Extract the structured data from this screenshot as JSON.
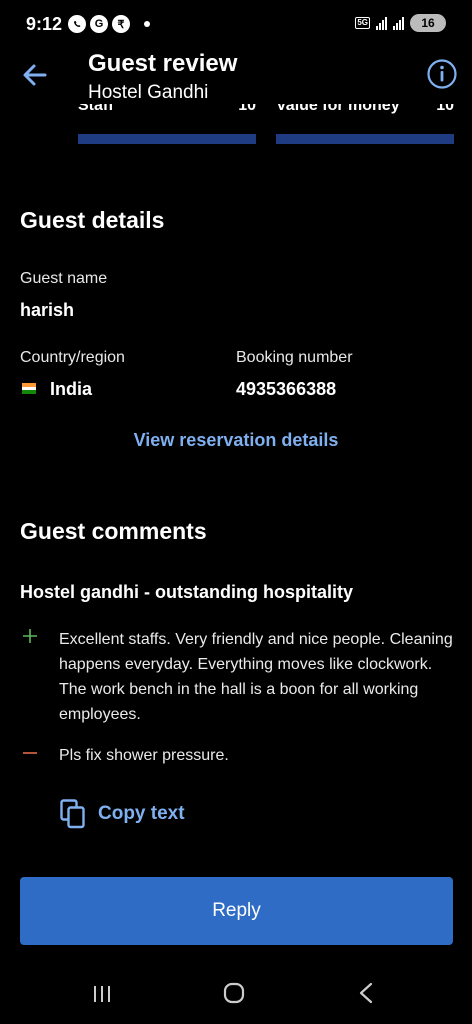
{
  "status_bar": {
    "time": "9:12",
    "left_icons": [
      "whatsapp-icon",
      "google-icon",
      "rupee-icon",
      "notification-dot"
    ],
    "rupee_glyph": "₹",
    "google_glyph": "G",
    "network": "5G",
    "battery": "16"
  },
  "header": {
    "title": "Guest review",
    "subtitle": "Hostel Gandhi"
  },
  "scores": [
    {
      "label": "Staff",
      "value": "10",
      "level": 1.0
    },
    {
      "label": "Value for money",
      "value": "10",
      "level": 1.0
    }
  ],
  "guest_details": {
    "heading": "Guest details",
    "name_label": "Guest name",
    "name_value": "harish",
    "country_label": "Country/region",
    "country_value": "India",
    "booking_label": "Booking number",
    "booking_value": "4935366388",
    "view_link": "View reservation details"
  },
  "guest_comments": {
    "heading": "Guest comments",
    "review_title": "Hostel gandhi - outstanding hospitality",
    "positive": "Excellent staffs. Very friendly and nice people. Cleaning happens everyday. Everything moves like clockwork. The work bench in the hall is a boon for all working employees.",
    "negative": "Pls fix shower pressure.",
    "copy_label": "Copy text"
  },
  "reply_button": "Reply",
  "colors": {
    "accent": "#2f6cc5",
    "link": "#7fb0f0",
    "positive": "#5cb85c",
    "negative": "#e06a4a",
    "score_bar": "#1f3b82"
  }
}
